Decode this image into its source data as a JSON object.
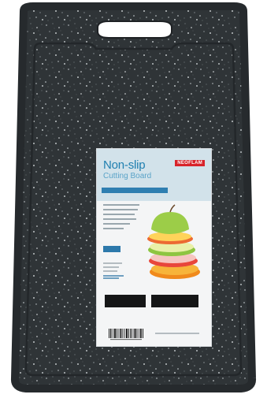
{
  "scene": {
    "subject": "cutting board product photo",
    "board_color": "#2f3437",
    "handle": "cutout handle"
  },
  "label": {
    "brand": "NEOFLAM",
    "title": "Non-slip",
    "subtitle": "Cutting Board"
  },
  "colors": {
    "board": "#2f3437",
    "board_edge": "#262a2d",
    "label_bg": "#f4f5f6",
    "label_accent": "#2f7fb1",
    "brand_red": "#d8232a"
  }
}
